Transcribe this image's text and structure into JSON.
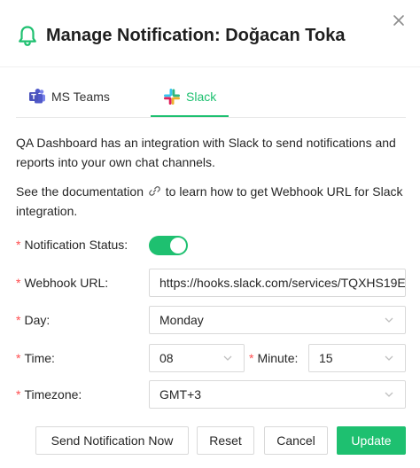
{
  "header": {
    "title": "Manage Notification: Doğacan Toka",
    "bell_icon": "bell-icon",
    "close_icon": "close-icon",
    "accent": "#1ec070"
  },
  "tabs": [
    {
      "label": "MS Teams",
      "icon": "ms-teams-icon",
      "active": false
    },
    {
      "label": "Slack",
      "icon": "slack-icon",
      "active": true
    }
  ],
  "description": {
    "line1": "QA Dashboard has an integration with Slack to send notifications and reports into your own chat channels.",
    "docs_before": "See the documentation",
    "docs_after": "to learn how to get Webhook URL for Slack integration.",
    "link_icon": "link-icon"
  },
  "form": {
    "notification_status": {
      "label": "Notification Status",
      "enabled": true
    },
    "webhook_url": {
      "label": "Webhook URL",
      "value": "https://hooks.slack.com/services/TQXHS19E"
    },
    "day": {
      "label": "Day",
      "value": "Monday"
    },
    "time": {
      "label": "Time",
      "value": "08"
    },
    "minute": {
      "label": "Minute",
      "value": "15"
    },
    "timezone": {
      "label": "Timezone",
      "value": "GMT+3"
    },
    "required_mark": "*",
    "colon": ":"
  },
  "footer": {
    "send_now": "Send Notification Now",
    "reset": "Reset",
    "cancel": "Cancel",
    "update": "Update"
  }
}
